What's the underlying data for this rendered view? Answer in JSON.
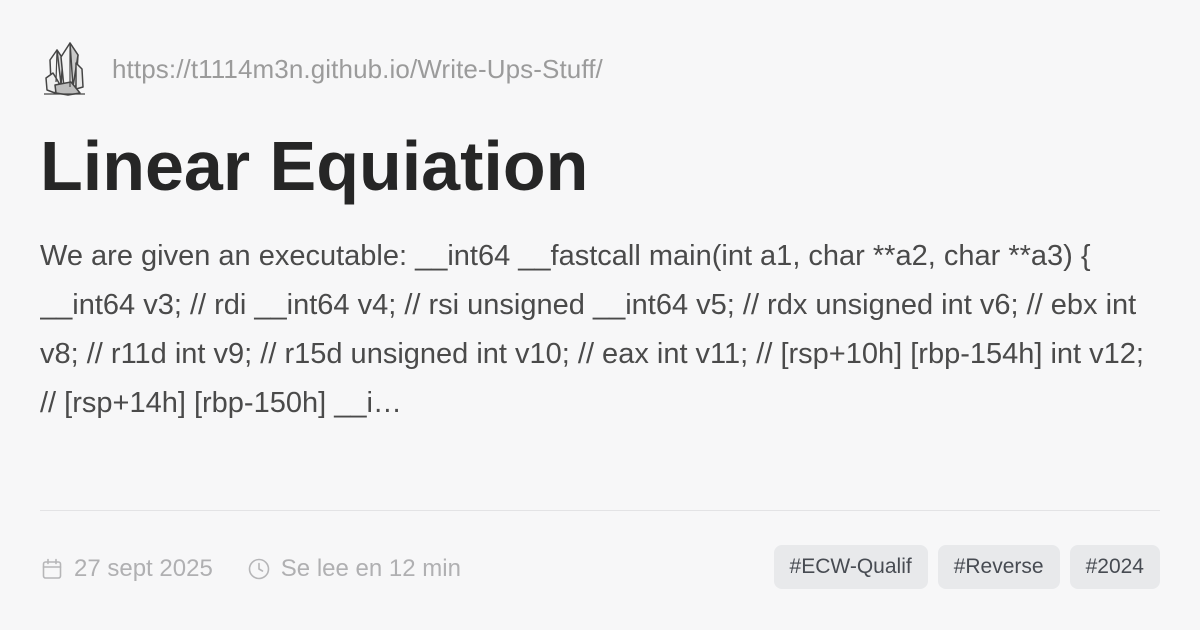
{
  "site": {
    "logo_icon": "crystal-cluster-logo-icon",
    "url": "https://t1114m3n.github.io/Write-Ups-Stuff/"
  },
  "post": {
    "title": "Linear Equiation",
    "excerpt": "We are given an executable: __int64 __fastcall main(int a1, char **a2, char **a3) { __int64 v3; // rdi __int64 v4; // rsi unsigned __int64 v5; // rdx unsigned int v6; // ebx int v8; // r11d int v9; // r15d unsigned int v10; // eax int v11; // [rsp+10h] [rbp-154h] int v12; // [rsp+14h] [rbp-150h] __i…"
  },
  "meta": {
    "date_icon": "calendar-icon",
    "date": "27 sept 2025",
    "reading_time_icon": "clock-icon",
    "reading_time": "Se lee en 12 min"
  },
  "tags": [
    {
      "label": "#ECW-Qualif"
    },
    {
      "label": "#Reverse"
    },
    {
      "label": "#2024"
    }
  ],
  "colors": {
    "background": "#f7f7f8",
    "title": "#262626",
    "body_text": "#4a4a4a",
    "muted_text": "#9b9b9b",
    "tag_background": "#e8e9eb",
    "tag_text": "#474b52"
  }
}
